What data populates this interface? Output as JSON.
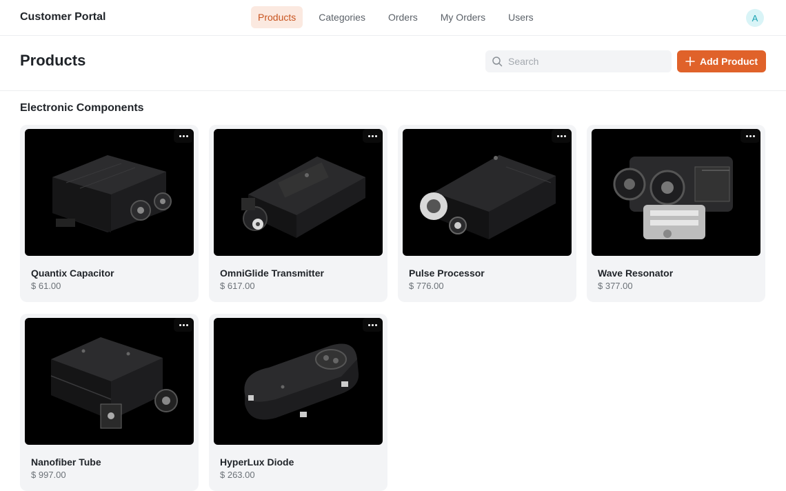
{
  "brand": "Customer Portal",
  "nav": [
    {
      "label": "Products",
      "active": true
    },
    {
      "label": "Categories",
      "active": false
    },
    {
      "label": "Orders",
      "active": false
    },
    {
      "label": "My Orders",
      "active": false
    },
    {
      "label": "Users",
      "active": false
    }
  ],
  "avatar": "A",
  "header": {
    "title": "Products",
    "search_placeholder": "Search",
    "add_label": "Add Product"
  },
  "section": {
    "title": "Electronic Components",
    "products": [
      {
        "name": "Quantix Capacitor",
        "price": "$ 61.00"
      },
      {
        "name": "OmniGlide Transmitter",
        "price": "$ 617.00"
      },
      {
        "name": "Pulse Processor",
        "price": "$ 776.00"
      },
      {
        "name": "Wave Resonator",
        "price": "$ 377.00"
      },
      {
        "name": "Nanofiber Tube",
        "price": "$ 997.00"
      },
      {
        "name": "HyperLux Diode",
        "price": "$ 263.00"
      }
    ]
  },
  "colors": {
    "accent": "#e0622a",
    "nav_active_bg": "#fbe9e0",
    "nav_active_text": "#c8541f",
    "card_bg": "#f3f4f6",
    "avatar_bg": "#d9f4f7"
  },
  "icons": {
    "search": "search-icon",
    "add": "plus-icon",
    "more": "more-horizontal-icon"
  }
}
